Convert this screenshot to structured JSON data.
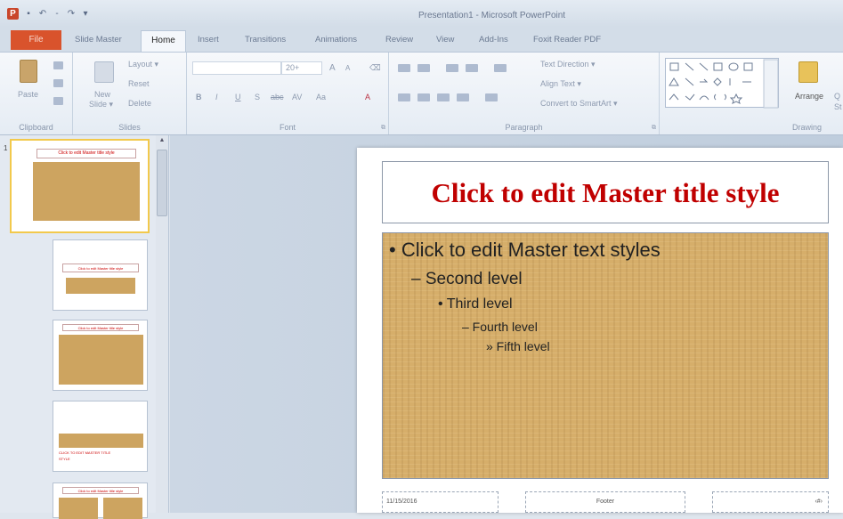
{
  "window": {
    "title": "Presentation1 - Microsoft PowerPoint"
  },
  "qat": {
    "app_letter": "P",
    "save": "▪",
    "undo": "↶",
    "dash": "-",
    "redo": "↷",
    "customize": "▾"
  },
  "tabs": {
    "file": "File",
    "slide_master": "Slide Master",
    "home": "Home",
    "insert": "Insert",
    "transitions": "Transitions",
    "animations": "Animations",
    "review": "Review",
    "view": "View",
    "addins": "Add-Ins",
    "foxit": "Foxit Reader PDF"
  },
  "ribbon": {
    "clipboard": {
      "label": "Clipboard",
      "paste": "Paste",
      "launcher": "⧉"
    },
    "slides": {
      "label": "Slides",
      "new_slide": "New",
      "new_slide2": "Slide ▾",
      "layout": "Layout ▾",
      "reset": "Reset",
      "delete": "Delete"
    },
    "font": {
      "label": "Font",
      "size": "20+",
      "grow": "A",
      "shrink": "A",
      "clear": "⌫",
      "bold": "B",
      "italic": "I",
      "underline": "U",
      "strike": "S",
      "abc": "abc",
      "spacing": "AV",
      "case": "Aa",
      "color": "A",
      "launcher": "⧉"
    },
    "paragraph": {
      "label": "Paragraph",
      "text_direction": "Text Direction ▾",
      "align_text": "Align Text ▾",
      "smartart": "Convert to SmartArt ▾",
      "launcher": "⧉"
    },
    "drawing": {
      "label": "Drawing",
      "arrange": "Arrange",
      "quick": "Q",
      "quick2": "St"
    }
  },
  "thumbnails": [
    {
      "num": "1",
      "title": "Click to edit Master title style"
    },
    {
      "title": "Click to edit Master title style"
    },
    {
      "title": "Click to edit Master title style"
    },
    {
      "title": "CLICK TO EDIT MASTER TITLE STYLE"
    },
    {
      "title": "Click to edit Master title style"
    }
  ],
  "slide": {
    "title": "Click to edit Master title style",
    "level1": "• Click to edit Master text styles",
    "level2": "– Second level",
    "level3": "• Third level",
    "level4": "– Fourth level",
    "level5": "» Fifth level",
    "footer_date": "11/15/2016",
    "footer_text": "Footer",
    "footer_num": "‹#›"
  },
  "colors": {
    "accent": "#d9532c",
    "title_red": "#c00000",
    "wood": "#d6ae6a"
  }
}
